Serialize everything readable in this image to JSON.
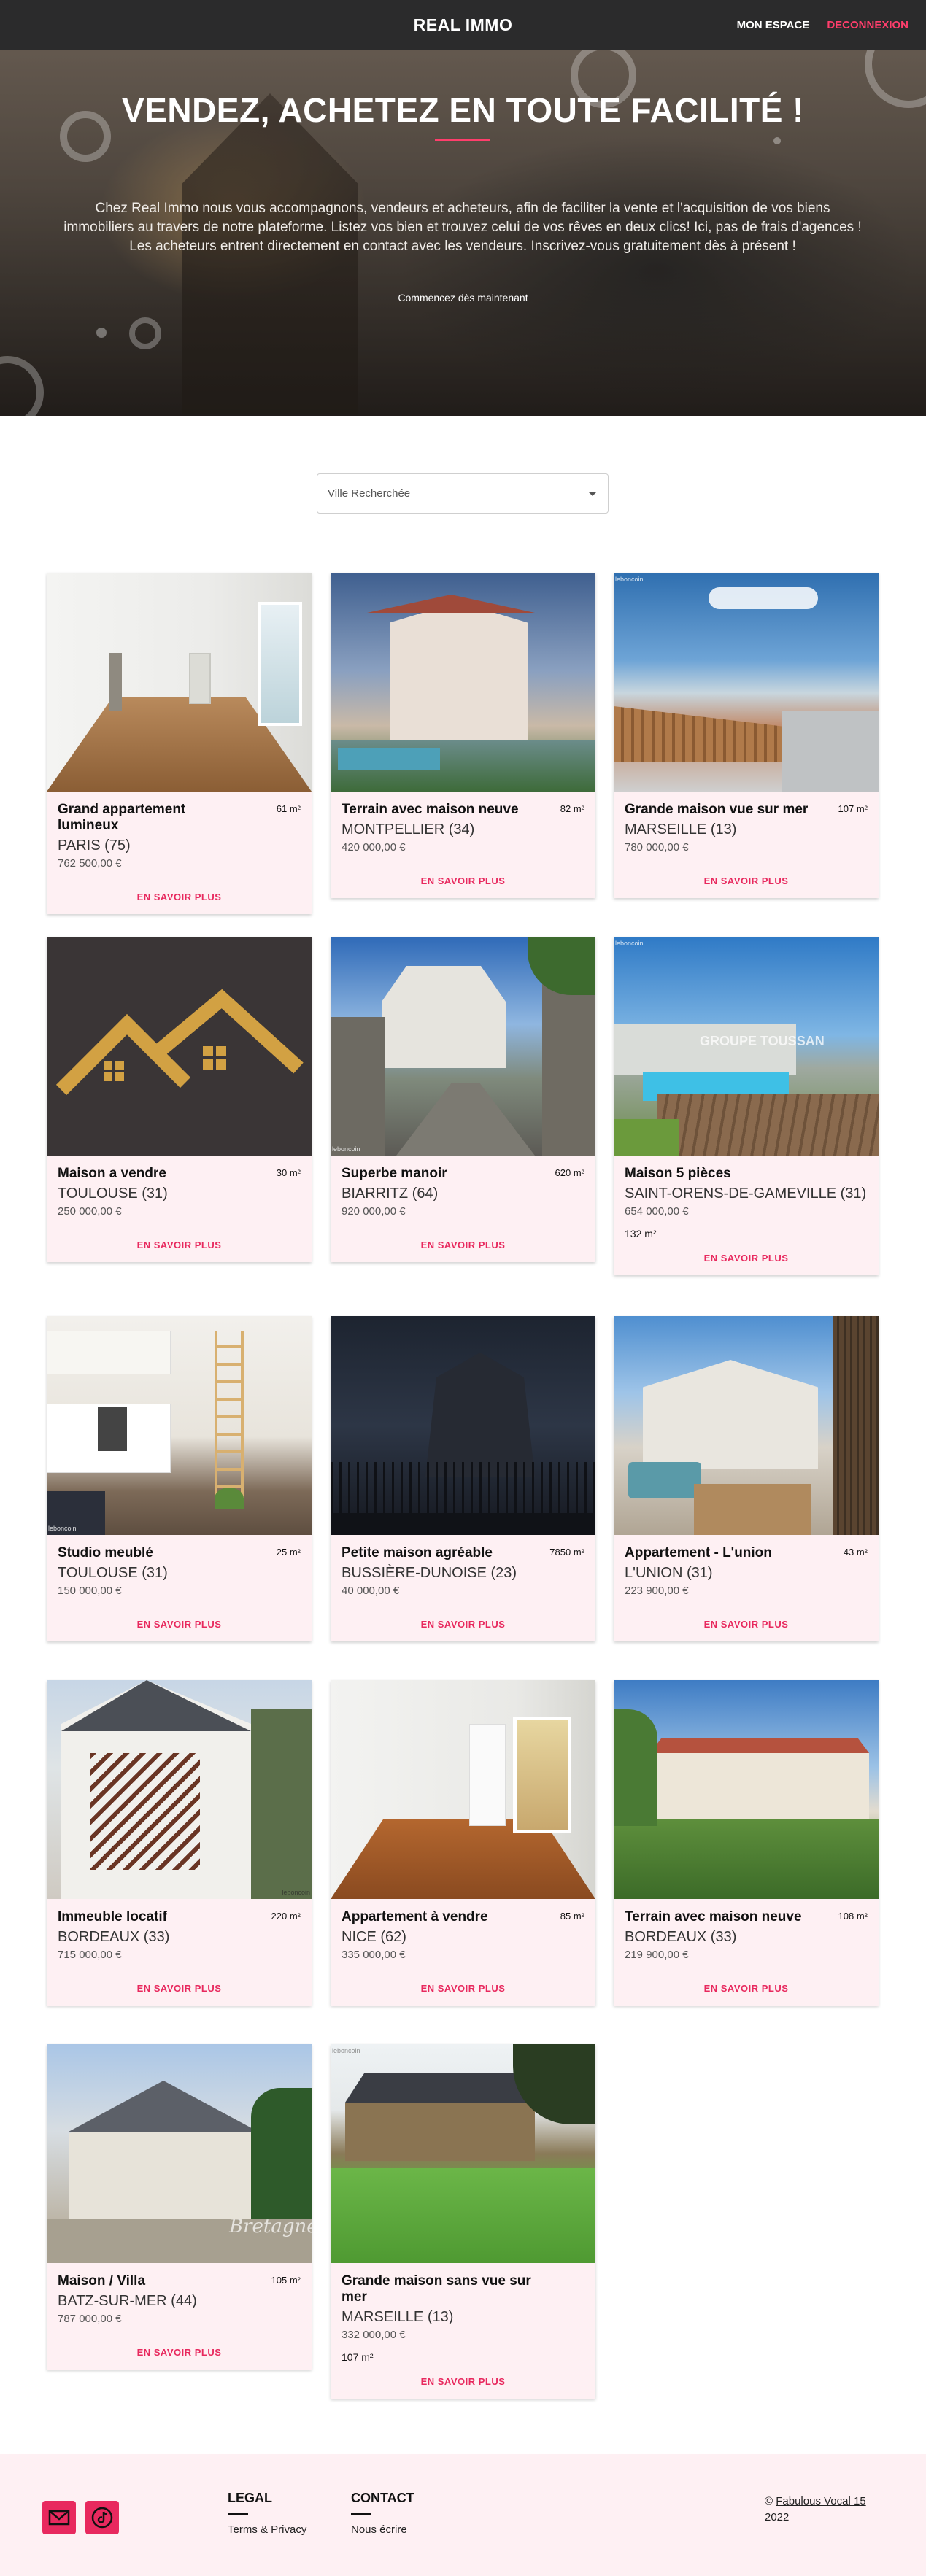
{
  "navbar": {
    "brand": "REAL IMMO",
    "my_space": "MON ESPACE",
    "logout": "DECONNEXION"
  },
  "hero": {
    "title": "VENDEZ, ACHETEZ EN TOUTE FACILITÉ !",
    "text": "Chez Real Immo nous vous accompagnons, vendeurs et acheteurs, afin de faciliter la vente et l'acquisition de vos biens immobiliers au travers de notre plateforme. Listez vos bien et trouvez celui de vos rêves en deux clics! Ici, pas de frais d'agences ! Les acheteurs entrent directement en contact avec les vendeurs. Inscrivez-vous gratuitement dès à présent !",
    "cta": "Commencez dès maintenant"
  },
  "search": {
    "placeholder": "Ville Recherchée"
  },
  "listings": [
    {
      "title": "Grand appartement lumineux",
      "area": "61 m²",
      "city": "PARIS (75)",
      "price": "762 500,00 €",
      "more": "EN SAVOIR PLUS"
    },
    {
      "title": "Terrain avec maison neuve",
      "area": "82 m²",
      "city": "MONTPELLIER (34)",
      "price": "420 000,00 €",
      "more": "EN SAVOIR PLUS"
    },
    {
      "title": "Grande maison vue sur mer",
      "area": "107 m²",
      "city": "MARSEILLE (13)",
      "price": "780 000,00 €",
      "more": "EN SAVOIR PLUS"
    },
    {
      "title": "Maison a vendre",
      "area": "30 m²",
      "city": "TOULOUSE (31)",
      "price": "250 000,00 €",
      "more": "EN SAVOIR PLUS"
    },
    {
      "title": "Superbe manoir",
      "area": "620 m²",
      "city": "BIARRITZ (64)",
      "price": "920 000,00 €",
      "more": "EN SAVOIR PLUS"
    },
    {
      "title": "Maison 5 pièces",
      "area": "132 m²",
      "city": "SAINT-ORENS-DE-GAMEVILLE (31)",
      "price": "654 000,00 €",
      "more": "EN SAVOIR PLUS"
    },
    {
      "title": "Studio meublé",
      "area": "25 m²",
      "city": "TOULOUSE (31)",
      "price": "150 000,00 €",
      "more": "EN SAVOIR PLUS"
    },
    {
      "title": "Petite maison agréable",
      "area": "7850 m²",
      "city": "BUSSIÈRE-DUNOISE (23)",
      "price": "40 000,00 €",
      "more": "EN SAVOIR PLUS"
    },
    {
      "title": "Appartement - L'union",
      "area": "43 m²",
      "city": "L'UNION (31)",
      "price": "223 900,00 €",
      "more": "EN SAVOIR PLUS"
    },
    {
      "title": "Immeuble locatif",
      "area": "220 m²",
      "city": "BORDEAUX (33)",
      "price": "715 000,00 €",
      "more": "EN SAVOIR PLUS"
    },
    {
      "title": "Appartement à vendre",
      "area": "85 m²",
      "city": "NICE (62)",
      "price": "335 000,00 €",
      "more": "EN SAVOIR PLUS"
    },
    {
      "title": "Terrain avec maison neuve",
      "area": "108 m²",
      "city": "BORDEAUX (33)",
      "price": "219 900,00 €",
      "more": "EN SAVOIR PLUS"
    },
    {
      "title": "Maison / Villa",
      "area": "105 m²",
      "city": "BATZ-SUR-MER (44)",
      "price": "787 000,00 €",
      "more": "EN SAVOIR PLUS"
    },
    {
      "title": "Grande maison sans vue sur mer",
      "area": "107 m²",
      "city": "MARSEILLE (13)",
      "price": "332 000,00 €",
      "more": "EN SAVOIR PLUS"
    }
  ],
  "image_watermarks": {
    "leboncoin": "leboncoin",
    "groupe": "GROUPE TOUSSAN",
    "bretagne": "Bretagne"
  },
  "footer": {
    "legal_heading": "LEGAL",
    "legal_link": "Terms & Privacy",
    "contact_heading": "CONTACT",
    "contact_link": "Nous écrire",
    "copyright_prefix": "© ",
    "copyright_link": "Fabulous Vocal 15",
    "copyright_year": "2022"
  },
  "colors": {
    "accent": "#e8295e",
    "navbar": "#2b2b2c",
    "card_bg": "#fef0f3",
    "footer_bg": "#fef0f3"
  }
}
